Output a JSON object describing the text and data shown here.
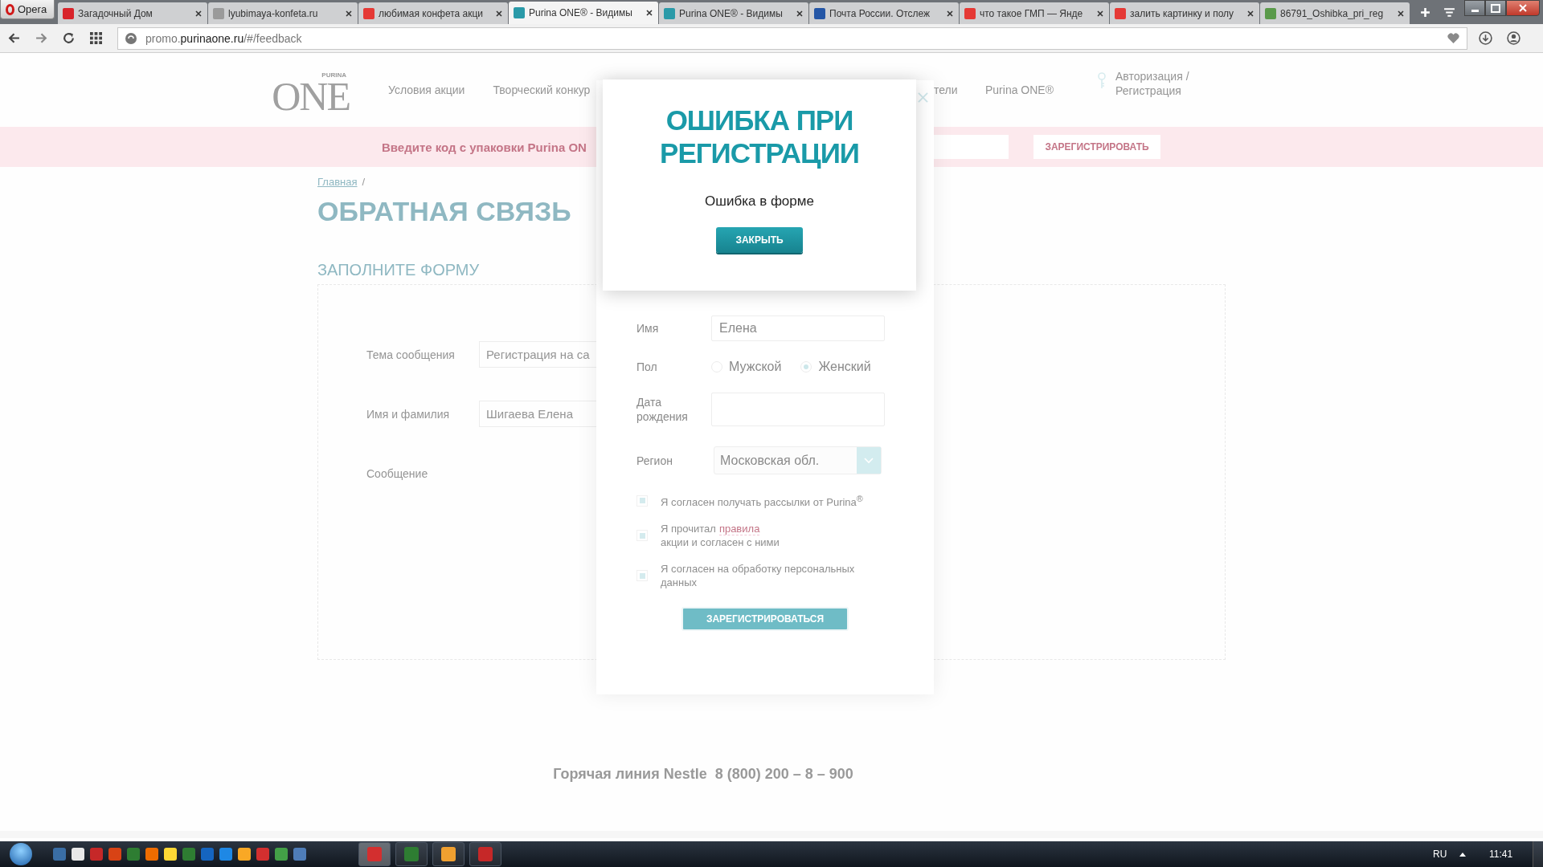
{
  "browser": {
    "menu_label": "Opera",
    "tabs": [
      {
        "title": "Загадочный Дом",
        "selected": false
      },
      {
        "title": "lyubimaya-konfeta.ru",
        "selected": false
      },
      {
        "title": "любимая конфета акци",
        "selected": false
      },
      {
        "title": "Purina ONE® - Видимы",
        "selected": true
      },
      {
        "title": "Purina ONE® - Видимы",
        "selected": false
      },
      {
        "title": "Почта России. Отслеж",
        "selected": false
      },
      {
        "title": "что такое ГМП — Янде",
        "selected": false
      },
      {
        "title": "залить картинку и полу",
        "selected": false
      },
      {
        "title": "86791_Oshibka_pri_reg",
        "selected": false
      }
    ],
    "address": {
      "prefix": "promo.",
      "host": "purinaone.ru",
      "path": "/#/feedback"
    }
  },
  "page": {
    "logo": {
      "brand": "PURINA",
      "name": "ONE"
    },
    "nav": [
      "Условия акции",
      "Творческий конкур",
      "тели",
      "Purina ONE®"
    ],
    "auth": "Авторизация / Регистрация",
    "code_banner": {
      "text": "Введите код с упаковки Purina ON",
      "button": "ЗАРЕГИСТРИРОВАТЬ"
    },
    "breadcrumb": {
      "link": "Главная",
      "separator": "/"
    },
    "title": "ОБРАТНАЯ СВЯЗЬ",
    "form_heading": "ЗАПОЛНИТЕ ФОРМУ",
    "feedback_form": [
      {
        "label": "Тема сообщения",
        "value": "Регистрация на са"
      },
      {
        "label": "Имя и фамилия",
        "value": "Шигаева Елена"
      },
      {
        "label": "Сообщение"
      }
    ],
    "hotline": "Горячая линия Nestle  8 (800) 200 – 8 – 900"
  },
  "registration_panel": {
    "fields": [
      {
        "kind": "text",
        "label": "Имя",
        "value": "Елена"
      },
      {
        "kind": "radio",
        "label": "Пол",
        "options": [
          {
            "label": "Мужской",
            "selected": false
          },
          {
            "label": "Женский",
            "selected": true
          }
        ]
      },
      {
        "kind": "text",
        "label": "Дата рождения"
      },
      {
        "kind": "select",
        "label": "Регион",
        "value": "Московская обл."
      }
    ],
    "agreements": [
      {
        "before": "Я согласен получать рассылки от Purina$^{®}$",
        "checked": true
      },
      {
        "before": "Я прочитал",
        "link": "правила",
        "after": "акции и согласен с ними",
        "checked": true
      },
      {
        "before": "Я согласен на обработку персональных данных",
        "checked": true
      }
    ],
    "submit": "ЗАРЕГИСТРИРОВАТЬСЯ"
  },
  "dialog": {
    "title": "ОШИБКА ПРИ РЕГИСТРАЦИИ",
    "message": "Ошибка в форме",
    "button": "ЗАКРЫТЬ"
  },
  "taskbar": {
    "language": "RU",
    "time": "11:41"
  }
}
